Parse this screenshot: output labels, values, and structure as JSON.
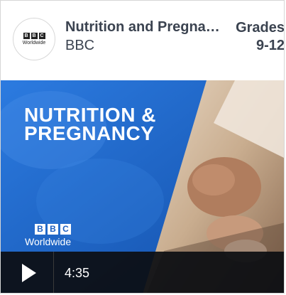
{
  "header": {
    "logo_icon": "bbc-worldwide-logo",
    "logo_letters": [
      "B",
      "B",
      "C"
    ],
    "logo_subtext": "Worldwide",
    "title": "Nutrition and Pregnancy",
    "publisher": "BBC",
    "grades_label": "Grades",
    "grades_range": "9-12"
  },
  "video": {
    "title_line1": "NUTRITION &",
    "title_line2": "PREGNANCY",
    "brand_letters": [
      "B",
      "B",
      "C"
    ],
    "brand_subtext": "Worldwide",
    "play_icon": "play-icon",
    "duration": "4:35"
  },
  "colors": {
    "text": "#3b4350",
    "thumbnail_blue": "#1d63c6",
    "control_bar": "#0c0e12"
  }
}
